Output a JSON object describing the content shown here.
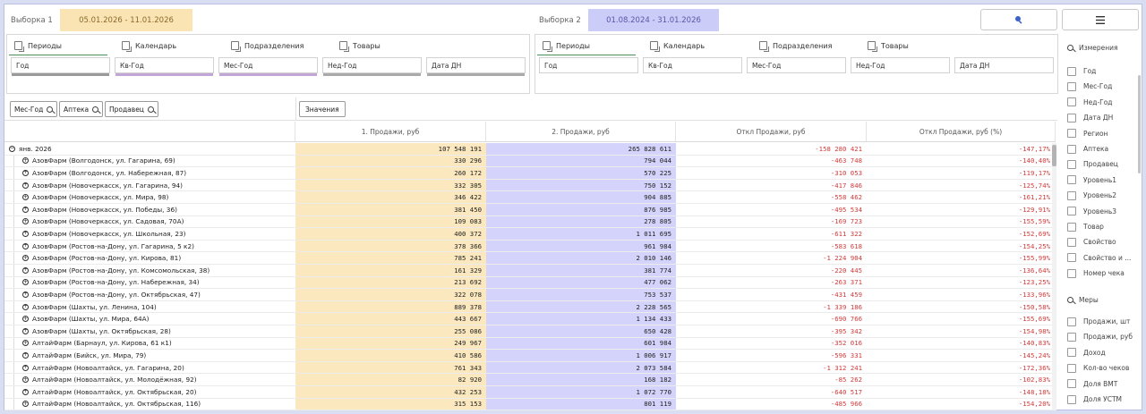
{
  "top": {
    "sel1_label": "Выборка 1",
    "sel1_dates": "05.01.2026 - 11.01.2026",
    "sel2_label": "Выборка 2",
    "sel2_dates": "01.08.2024 - 31.01.2026",
    "search_icon": "search-icon",
    "menu_icon": "menu-icon"
  },
  "panel1": {
    "tabs": [
      "Периоды",
      "Календарь",
      "Подразделения",
      "Товары"
    ],
    "fields": [
      "Год",
      "Кв-Год",
      "Мес-Год",
      "Нед-Год",
      "Дата ДН"
    ]
  },
  "panel2": {
    "tabs": [
      "Периоды",
      "Календарь",
      "Подразделения",
      "Товары"
    ],
    "fields": [
      "Год",
      "Кв-Год",
      "Мес-Год",
      "Нед-Год",
      "Дата ДН"
    ]
  },
  "table": {
    "dim_chips": [
      "Мес-Год",
      "Аптека",
      "Продавец"
    ],
    "values_chip": "Значения",
    "headers": [
      "1. Продажи, руб",
      "2. Продажи, руб",
      "Откл Продажи, руб",
      "Откл Продажи, руб (%)"
    ],
    "total": {
      "label": "янв. 2026",
      "v1": "107 548 191",
      "v2": "265 828 611",
      "v3": "-158 280 421",
      "v4": "-147,17%"
    },
    "rows": [
      {
        "label": "АзовФарм (Волгодонск, ул. Гагарина, 69)",
        "v1": "330 296",
        "v2": "794 044",
        "v3": "-463 748",
        "v4": "-140,40%"
      },
      {
        "label": "АзовФарм (Волгодонск, ул. Набережная, 87)",
        "v1": "260 172",
        "v2": "570 225",
        "v3": "-310 053",
        "v4": "-119,17%"
      },
      {
        "label": "АзовФарм (Новочеркасск, ул. Гагарина, 94)",
        "v1": "332 305",
        "v2": "750 152",
        "v3": "-417 846",
        "v4": "-125,74%"
      },
      {
        "label": "АзовФарм (Новочеркасск, ул. Мира, 98)",
        "v1": "346 422",
        "v2": "904 885",
        "v3": "-558 462",
        "v4": "-161,21%"
      },
      {
        "label": "АзовФарм (Новочеркасск, ул. Победы, 36)",
        "v1": "381 450",
        "v2": "876 985",
        "v3": "-495 534",
        "v4": "-129,91%"
      },
      {
        "label": "АзовФарм (Новочеркасск, ул. Садовая, 70А)",
        "v1": "109 083",
        "v2": "278 805",
        "v3": "-169 723",
        "v4": "-155,59%"
      },
      {
        "label": "АзовФарм (Новочеркасск, ул. Школьная, 23)",
        "v1": "400 372",
        "v2": "1 011 695",
        "v3": "-611 322",
        "v4": "-152,69%"
      },
      {
        "label": "АзовФарм (Ростов-на-Дону, ул. Гагарина, 5 к2)",
        "v1": "378 366",
        "v2": "961 984",
        "v3": "-583 618",
        "v4": "-154,25%"
      },
      {
        "label": "АзовФарм (Ростов-на-Дону, ул. Кирова, 81)",
        "v1": "785 241",
        "v2": "2 010 146",
        "v3": "-1 224 904",
        "v4": "-155,99%"
      },
      {
        "label": "АзовФарм (Ростов-на-Дону, ул. Комсомольская, 38)",
        "v1": "161 329",
        "v2": "381 774",
        "v3": "-220 445",
        "v4": "-136,64%"
      },
      {
        "label": "АзовФарм (Ростов-на-Дону, ул. Набережная, 34)",
        "v1": "213 692",
        "v2": "477 062",
        "v3": "-263 371",
        "v4": "-123,25%"
      },
      {
        "label": "АзовФарм (Ростов-на-Дону, ул. Октябрьская, 47)",
        "v1": "322 078",
        "v2": "753 537",
        "v3": "-431 459",
        "v4": "-133,96%"
      },
      {
        "label": "АзовФарм (Шахты, ул. Ленина, 104)",
        "v1": "889 378",
        "v2": "2 228 565",
        "v3": "-1 339 186",
        "v4": "-150,58%"
      },
      {
        "label": "АзовФарм (Шахты, ул. Мира, 64А)",
        "v1": "443 667",
        "v2": "1 134 433",
        "v3": "-690 766",
        "v4": "-155,69%"
      },
      {
        "label": "АзовФарм (Шахты, ул. Октябрьская, 28)",
        "v1": "255 086",
        "v2": "650 428",
        "v3": "-395 342",
        "v4": "-154,98%"
      },
      {
        "label": "АлтайФарм (Барнаул, ул. Кирова, 61 к1)",
        "v1": "249 967",
        "v2": "601 984",
        "v3": "-352 016",
        "v4": "-140,83%"
      },
      {
        "label": "АлтайФарм (Бийск, ул. Мира, 79)",
        "v1": "410 586",
        "v2": "1 006 917",
        "v3": "-596 331",
        "v4": "-145,24%"
      },
      {
        "label": "АлтайФарм (Новоалтайск, ул. Гагарина, 20)",
        "v1": "761 343",
        "v2": "2 073 584",
        "v3": "-1 312 241",
        "v4": "-172,36%"
      },
      {
        "label": "АлтайФарм (Новоалтайск, ул. Молодёжная, 92)",
        "v1": "82 920",
        "v2": "168 182",
        "v3": "-85 262",
        "v4": "-102,83%"
      },
      {
        "label": "АлтайФарм (Новоалтайск, ул. Октябрьская, 20)",
        "v1": "432 253",
        "v2": "1 072 770",
        "v3": "-640 517",
        "v4": "-148,18%"
      },
      {
        "label": "АлтайФарм (Новоалтайск, ул. Октябрьская, 116)",
        "v1": "315 153",
        "v2": "801 119",
        "v3": "-485 966",
        "v4": "-154,20%"
      }
    ]
  },
  "sidebar": {
    "dims_title": "Измерения",
    "dims": [
      "Год",
      "Мес-Год",
      "Нед-Год",
      "Дата ДН",
      "Регион",
      "Аптека",
      "Продавец",
      "Уровень1",
      "Уровень2",
      "Уровень3",
      "Товар",
      "Свойство",
      "Свойство и ...",
      "Номер чека"
    ],
    "measures_title": "Меры",
    "measures": [
      "Продажи, шт",
      "Продажи, руб",
      "Доход",
      "Кол-во чеков",
      "Доля ВМТ",
      "Доля УСТМ"
    ]
  }
}
